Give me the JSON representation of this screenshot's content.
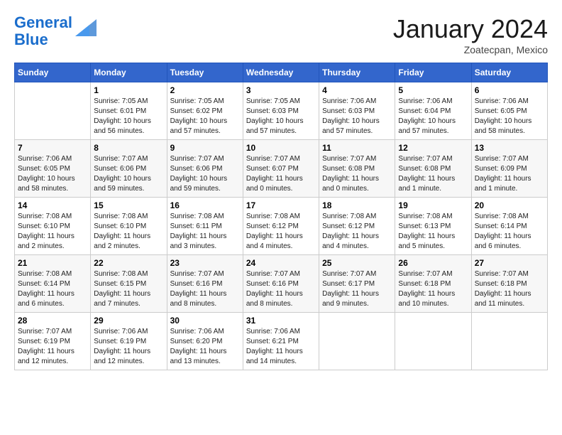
{
  "header": {
    "logo_line1": "General",
    "logo_line2": "Blue",
    "month": "January 2024",
    "location": "Zoatecpan, Mexico"
  },
  "days_of_week": [
    "Sunday",
    "Monday",
    "Tuesday",
    "Wednesday",
    "Thursday",
    "Friday",
    "Saturday"
  ],
  "weeks": [
    [
      {
        "day": "",
        "sunrise": "",
        "sunset": "",
        "daylight": ""
      },
      {
        "day": "1",
        "sunrise": "Sunrise: 7:05 AM",
        "sunset": "Sunset: 6:01 PM",
        "daylight": "Daylight: 10 hours and 56 minutes."
      },
      {
        "day": "2",
        "sunrise": "Sunrise: 7:05 AM",
        "sunset": "Sunset: 6:02 PM",
        "daylight": "Daylight: 10 hours and 57 minutes."
      },
      {
        "day": "3",
        "sunrise": "Sunrise: 7:05 AM",
        "sunset": "Sunset: 6:03 PM",
        "daylight": "Daylight: 10 hours and 57 minutes."
      },
      {
        "day": "4",
        "sunrise": "Sunrise: 7:06 AM",
        "sunset": "Sunset: 6:03 PM",
        "daylight": "Daylight: 10 hours and 57 minutes."
      },
      {
        "day": "5",
        "sunrise": "Sunrise: 7:06 AM",
        "sunset": "Sunset: 6:04 PM",
        "daylight": "Daylight: 10 hours and 57 minutes."
      },
      {
        "day": "6",
        "sunrise": "Sunrise: 7:06 AM",
        "sunset": "Sunset: 6:05 PM",
        "daylight": "Daylight: 10 hours and 58 minutes."
      }
    ],
    [
      {
        "day": "7",
        "sunrise": "Sunrise: 7:06 AM",
        "sunset": "Sunset: 6:05 PM",
        "daylight": "Daylight: 10 hours and 58 minutes."
      },
      {
        "day": "8",
        "sunrise": "Sunrise: 7:07 AM",
        "sunset": "Sunset: 6:06 PM",
        "daylight": "Daylight: 10 hours and 59 minutes."
      },
      {
        "day": "9",
        "sunrise": "Sunrise: 7:07 AM",
        "sunset": "Sunset: 6:06 PM",
        "daylight": "Daylight: 10 hours and 59 minutes."
      },
      {
        "day": "10",
        "sunrise": "Sunrise: 7:07 AM",
        "sunset": "Sunset: 6:07 PM",
        "daylight": "Daylight: 11 hours and 0 minutes."
      },
      {
        "day": "11",
        "sunrise": "Sunrise: 7:07 AM",
        "sunset": "Sunset: 6:08 PM",
        "daylight": "Daylight: 11 hours and 0 minutes."
      },
      {
        "day": "12",
        "sunrise": "Sunrise: 7:07 AM",
        "sunset": "Sunset: 6:08 PM",
        "daylight": "Daylight: 11 hours and 1 minute."
      },
      {
        "day": "13",
        "sunrise": "Sunrise: 7:07 AM",
        "sunset": "Sunset: 6:09 PM",
        "daylight": "Daylight: 11 hours and 1 minute."
      }
    ],
    [
      {
        "day": "14",
        "sunrise": "Sunrise: 7:08 AM",
        "sunset": "Sunset: 6:10 PM",
        "daylight": "Daylight: 11 hours and 2 minutes."
      },
      {
        "day": "15",
        "sunrise": "Sunrise: 7:08 AM",
        "sunset": "Sunset: 6:10 PM",
        "daylight": "Daylight: 11 hours and 2 minutes."
      },
      {
        "day": "16",
        "sunrise": "Sunrise: 7:08 AM",
        "sunset": "Sunset: 6:11 PM",
        "daylight": "Daylight: 11 hours and 3 minutes."
      },
      {
        "day": "17",
        "sunrise": "Sunrise: 7:08 AM",
        "sunset": "Sunset: 6:12 PM",
        "daylight": "Daylight: 11 hours and 4 minutes."
      },
      {
        "day": "18",
        "sunrise": "Sunrise: 7:08 AM",
        "sunset": "Sunset: 6:12 PM",
        "daylight": "Daylight: 11 hours and 4 minutes."
      },
      {
        "day": "19",
        "sunrise": "Sunrise: 7:08 AM",
        "sunset": "Sunset: 6:13 PM",
        "daylight": "Daylight: 11 hours and 5 minutes."
      },
      {
        "day": "20",
        "sunrise": "Sunrise: 7:08 AM",
        "sunset": "Sunset: 6:14 PM",
        "daylight": "Daylight: 11 hours and 6 minutes."
      }
    ],
    [
      {
        "day": "21",
        "sunrise": "Sunrise: 7:08 AM",
        "sunset": "Sunset: 6:14 PM",
        "daylight": "Daylight: 11 hours and 6 minutes."
      },
      {
        "day": "22",
        "sunrise": "Sunrise: 7:08 AM",
        "sunset": "Sunset: 6:15 PM",
        "daylight": "Daylight: 11 hours and 7 minutes."
      },
      {
        "day": "23",
        "sunrise": "Sunrise: 7:07 AM",
        "sunset": "Sunset: 6:16 PM",
        "daylight": "Daylight: 11 hours and 8 minutes."
      },
      {
        "day": "24",
        "sunrise": "Sunrise: 7:07 AM",
        "sunset": "Sunset: 6:16 PM",
        "daylight": "Daylight: 11 hours and 8 minutes."
      },
      {
        "day": "25",
        "sunrise": "Sunrise: 7:07 AM",
        "sunset": "Sunset: 6:17 PM",
        "daylight": "Daylight: 11 hours and 9 minutes."
      },
      {
        "day": "26",
        "sunrise": "Sunrise: 7:07 AM",
        "sunset": "Sunset: 6:18 PM",
        "daylight": "Daylight: 11 hours and 10 minutes."
      },
      {
        "day": "27",
        "sunrise": "Sunrise: 7:07 AM",
        "sunset": "Sunset: 6:18 PM",
        "daylight": "Daylight: 11 hours and 11 minutes."
      }
    ],
    [
      {
        "day": "28",
        "sunrise": "Sunrise: 7:07 AM",
        "sunset": "Sunset: 6:19 PM",
        "daylight": "Daylight: 11 hours and 12 minutes."
      },
      {
        "day": "29",
        "sunrise": "Sunrise: 7:06 AM",
        "sunset": "Sunset: 6:19 PM",
        "daylight": "Daylight: 11 hours and 12 minutes."
      },
      {
        "day": "30",
        "sunrise": "Sunrise: 7:06 AM",
        "sunset": "Sunset: 6:20 PM",
        "daylight": "Daylight: 11 hours and 13 minutes."
      },
      {
        "day": "31",
        "sunrise": "Sunrise: 7:06 AM",
        "sunset": "Sunset: 6:21 PM",
        "daylight": "Daylight: 11 hours and 14 minutes."
      },
      {
        "day": "",
        "sunrise": "",
        "sunset": "",
        "daylight": ""
      },
      {
        "day": "",
        "sunrise": "",
        "sunset": "",
        "daylight": ""
      },
      {
        "day": "",
        "sunrise": "",
        "sunset": "",
        "daylight": ""
      }
    ]
  ]
}
